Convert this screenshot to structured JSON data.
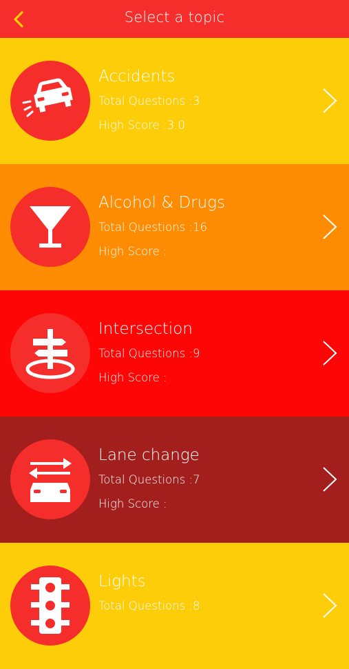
{
  "header": {
    "title": "Select a topic",
    "back_icon": "chevron-left-icon"
  },
  "colors": {
    "header": "#f52d2b",
    "circle": "#f52d2b",
    "yellow": "#fdcd0a",
    "orange": "#fe8c02",
    "red": "#fe0605",
    "dark_red": "#a21f1e"
  },
  "topics": [
    {
      "name": "Accidents",
      "total": "Total Questions :3",
      "score": "High Score :3.0",
      "icon": "car-crash-icon",
      "bg": "#fdcd0a"
    },
    {
      "name": "Alcohol & Drugs",
      "total": "Total Questions :16",
      "score": "High Score :",
      "icon": "cocktail-glass-icon",
      "bg": "#fe8c02"
    },
    {
      "name": "Intersection",
      "total": "Total Questions :9",
      "score": "High Score :",
      "icon": "signpost-icon",
      "bg": "#fe0605"
    },
    {
      "name": "Lane change",
      "total": "Total Questions :7",
      "score": "High Score :",
      "icon": "lane-change-icon",
      "bg": "#a21f1e"
    },
    {
      "name": "Lights",
      "total": "Total Questions :8",
      "score": "",
      "icon": "traffic-light-icon",
      "bg": "#fdcd0a"
    }
  ]
}
